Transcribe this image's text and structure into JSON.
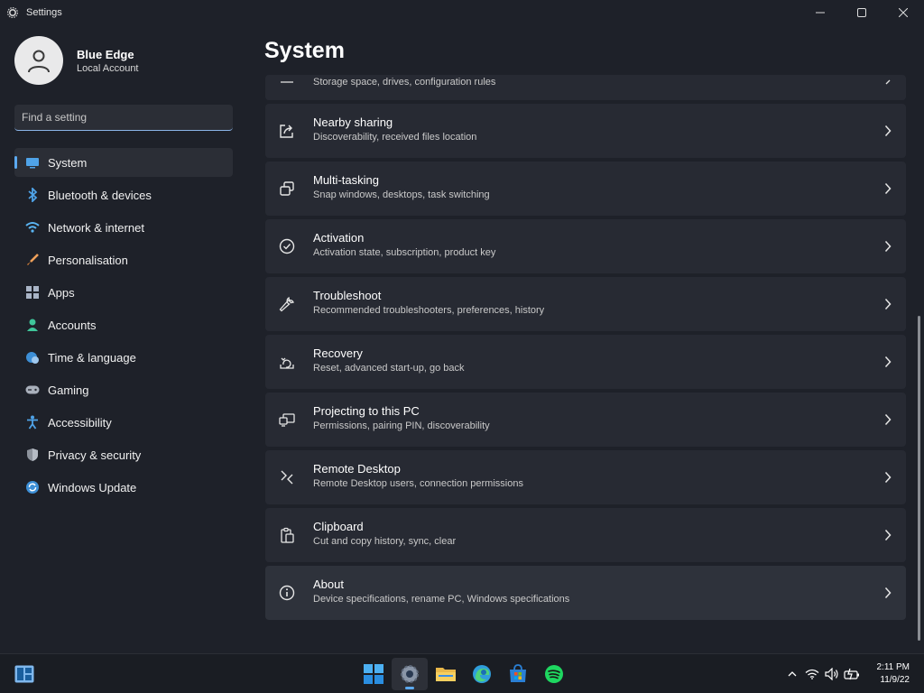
{
  "window": {
    "title": "Settings",
    "controls": {
      "minimize": "—",
      "maximize": "☐",
      "close": "✕"
    }
  },
  "profile": {
    "name": "Blue Edge",
    "account_type": "Local Account"
  },
  "search": {
    "placeholder": "Find a setting"
  },
  "sidebar": {
    "items": [
      {
        "label": "System",
        "icon": "monitor-icon",
        "active": true
      },
      {
        "label": "Bluetooth & devices",
        "icon": "bluetooth-icon"
      },
      {
        "label": "Network & internet",
        "icon": "wifi-icon"
      },
      {
        "label": "Personalisation",
        "icon": "brush-icon"
      },
      {
        "label": "Apps",
        "icon": "apps-icon"
      },
      {
        "label": "Accounts",
        "icon": "person-icon"
      },
      {
        "label": "Time & language",
        "icon": "globe-clock-icon"
      },
      {
        "label": "Gaming",
        "icon": "gamepad-icon"
      },
      {
        "label": "Accessibility",
        "icon": "accessibility-icon"
      },
      {
        "label": "Privacy & security",
        "icon": "shield-icon"
      },
      {
        "label": "Windows Update",
        "icon": "update-icon"
      }
    ]
  },
  "main": {
    "title": "System",
    "cards": [
      {
        "title": "",
        "subtitle": "Storage space, drives, configuration rules",
        "icon": "storage-icon"
      },
      {
        "title": "Nearby sharing",
        "subtitle": "Discoverability, received files location",
        "icon": "share-icon"
      },
      {
        "title": "Multi-tasking",
        "subtitle": "Snap windows, desktops, task switching",
        "icon": "multitask-icon"
      },
      {
        "title": "Activation",
        "subtitle": "Activation state, subscription, product key",
        "icon": "check-circle-icon"
      },
      {
        "title": "Troubleshoot",
        "subtitle": "Recommended troubleshooters, preferences, history",
        "icon": "wrench-icon"
      },
      {
        "title": "Recovery",
        "subtitle": "Reset, advanced start-up, go back",
        "icon": "recovery-icon"
      },
      {
        "title": "Projecting to this PC",
        "subtitle": "Permissions, pairing PIN, discoverability",
        "icon": "project-icon"
      },
      {
        "title": "Remote Desktop",
        "subtitle": "Remote Desktop users, connection permissions",
        "icon": "remote-icon"
      },
      {
        "title": "Clipboard",
        "subtitle": "Cut and copy history, sync, clear",
        "icon": "clipboard-icon"
      },
      {
        "title": "About",
        "subtitle": "Device specifications, rename PC, Windows specifications",
        "icon": "info-icon"
      }
    ]
  },
  "taskbar": {
    "apps": [
      "start-icon",
      "settings-icon",
      "file-explorer-icon",
      "edge-icon",
      "store-icon",
      "spotify-icon"
    ],
    "tray": [
      "chevron-up-icon",
      "wifi-icon",
      "volume-icon",
      "battery-icon"
    ],
    "time": "2:11 PM",
    "date": "11/9/22"
  },
  "colors": {
    "accent": "#5ba9f0",
    "background": "#1e2129",
    "card": "#272a33"
  }
}
